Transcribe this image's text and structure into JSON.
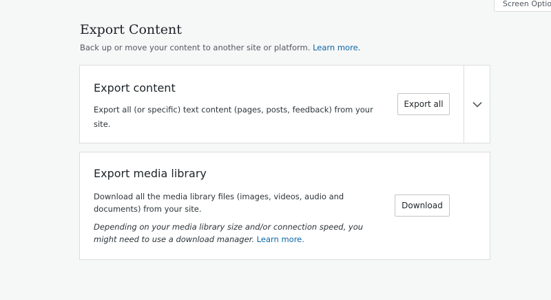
{
  "header": {
    "screen_options_label": "Screen Options",
    "title": "Export Content",
    "subtitle": "Back up or move your content to another site or platform.",
    "learn_more": "Learn more."
  },
  "export_card": {
    "title": "Export content",
    "description_line1": "Export all (or specific) text content (pages, posts, feedback) from your",
    "description_line2": "site.",
    "button_label": "Export all",
    "toggle_icon": "chevron-down-icon"
  },
  "media_card": {
    "title": "Export media library",
    "description_line1": "Download all the media library files (images, videos, audio and",
    "description_line2": "documents) from your site.",
    "note_line1": "Depending on your media library size and/or connection speed, you",
    "note_line2": "might need to use a download manager.",
    "note_learn_more": "Learn more.",
    "button_label": "Download"
  }
}
